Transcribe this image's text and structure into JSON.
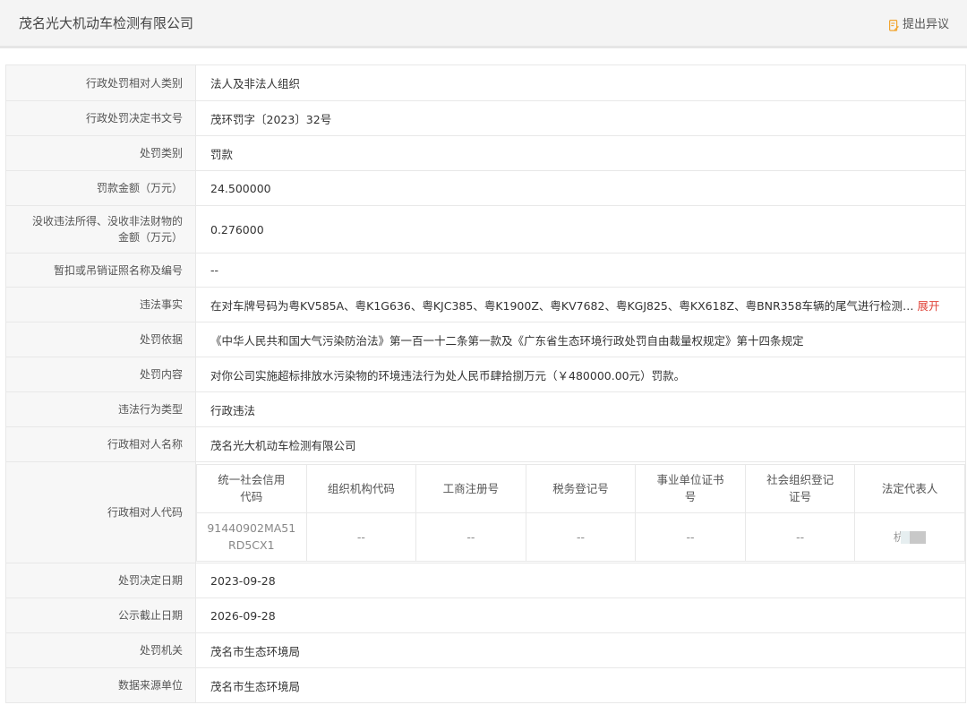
{
  "header": {
    "title": "茂名光大机动车检测有限公司",
    "objection_label": "提出异议",
    "objection_icon": "edit-document-icon",
    "objection_icon_color": "#f2a531"
  },
  "rows": {
    "party_type": {
      "label": "行政处罚相对人类别",
      "value": "法人及非法人组织"
    },
    "decision_no": {
      "label": "行政处罚决定书文号",
      "value": "茂环罚字〔2023〕32号"
    },
    "penalty_type": {
      "label": "处罚类别",
      "value": "罚款"
    },
    "fine_amount": {
      "label": "罚款金额（万元）",
      "value": "24.500000"
    },
    "confiscation": {
      "label_line1": "没收违法所得、没收非法财物的",
      "label_line2": "金额（万元）",
      "value": "0.276000"
    },
    "license": {
      "label": "暂扣或吊销证照名称及编号",
      "value": "--"
    },
    "facts": {
      "label": "违法事实",
      "value": "在对车牌号码为粤KV585A、粤K1G636、粤KJC385、粤K1900Z、粤KV7682、粤KGJ825、粤KX618Z、粤BNR358车辆的尾气进行检测…",
      "expand_label": "展开",
      "expand_color": "#e0463b"
    },
    "basis": {
      "label": "处罚依据",
      "value": "《中华人民共和国大气污染防治法》第一百一十二条第一款及《广东省生态环境行政处罚自由裁量权规定》第十四条规定"
    },
    "content": {
      "label": "处罚内容",
      "value": "对你公司实施超标排放水污染物的环境违法行为处人民币肆拾捌万元（￥480000.00元）罚款。"
    },
    "violation_type": {
      "label": "违法行为类型",
      "value": "行政违法"
    },
    "party_name": {
      "label": "行政相对人名称",
      "value": "茂名光大机动车检测有限公司"
    },
    "party_code": {
      "label": "行政相对人代码",
      "headers": [
        {
          "l1": "统一社会信用",
          "l2": "代码"
        },
        {
          "l1": "组织机构代码",
          "l2": ""
        },
        {
          "l1": "工商注册号",
          "l2": ""
        },
        {
          "l1": "税务登记号",
          "l2": ""
        },
        {
          "l1": "事业单位证书",
          "l2": "号"
        },
        {
          "l1": "社会组织登记",
          "l2": "证号"
        },
        {
          "l1": "法定代表人",
          "l2": ""
        }
      ],
      "values": [
        {
          "l1": "91440902MA51",
          "l2": "RD5CX1"
        },
        {
          "l1": "--",
          "l2": ""
        },
        {
          "l1": "--",
          "l2": ""
        },
        {
          "l1": "--",
          "l2": ""
        },
        {
          "l1": "--",
          "l2": ""
        },
        {
          "l1": "--",
          "l2": ""
        },
        {
          "l1": "杭",
          "l2": ""
        }
      ]
    },
    "decision_date": {
      "label": "处罚决定日期",
      "value": "2023-09-28"
    },
    "publicity_end": {
      "label": "公示截止日期",
      "value": "2026-09-28"
    },
    "authority": {
      "label": "处罚机关",
      "value": "茂名市生态环境局"
    },
    "source": {
      "label": "数据来源单位",
      "value": "茂名市生态环境局"
    }
  }
}
